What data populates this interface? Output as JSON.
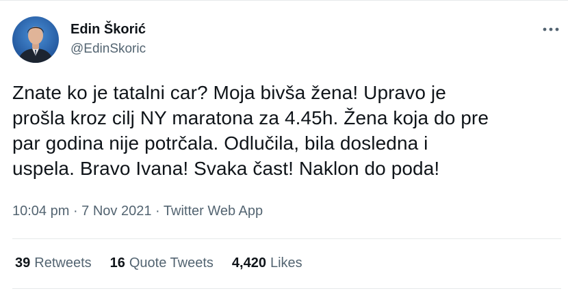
{
  "author": {
    "display_name": "Edin Škorić",
    "handle": "@EdinSkoric",
    "avatar_icon": "profile-photo"
  },
  "more_icon": "more-dots-icon",
  "tweet": {
    "lines": [
      "Znate ko je tatalni car? Moja bivša žena! Upravo je",
      "prošla kroz cilj NY maratona za 4.45h. Žena koja do pre",
      "par godina nije potrčala. Odlučila, bila dosledna i",
      "uspela. Bravo Ivana! Svaka čast! Naklon do poda!"
    ]
  },
  "meta": {
    "time": "10:04 pm",
    "separator": " · ",
    "date": "7 Nov 2021",
    "source": "Twitter Web App"
  },
  "stats": {
    "retweets_count": "39",
    "retweets_label": "Retweets",
    "quote_count": "16",
    "quote_label": "Quote Tweets",
    "likes_count": "4,420",
    "likes_label": "Likes"
  },
  "colors": {
    "text_primary": "#0f1419",
    "text_secondary": "#536471",
    "divider": "#e6e9ea"
  }
}
